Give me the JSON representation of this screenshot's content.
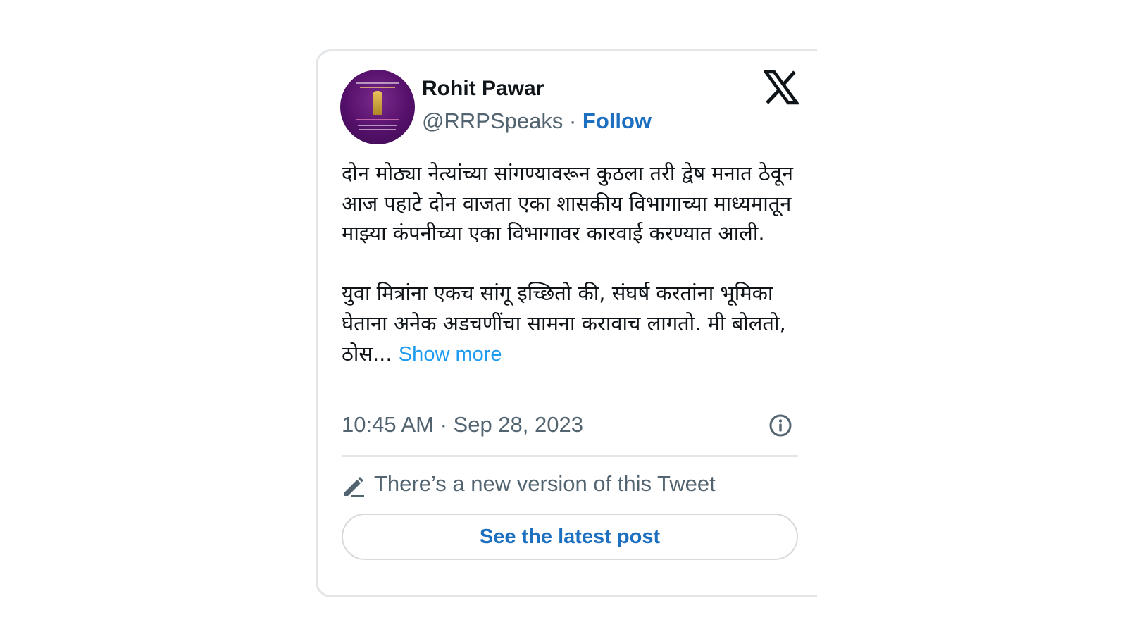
{
  "tweet": {
    "author_name": "Rohit Pawar",
    "handle": "@RRPSpeaks",
    "separator": " · ",
    "follow_label": "Follow",
    "text": "दोन मोठ्या नेत्यांच्या सांगण्यावरून कुठला तरी द्वेष मनात ठेवून आज पहाटे दोन वाजता एका शासकीय विभागाच्या माध्यमातून माझ्या कंपनीच्या एका विभागावर कारवाई करण्यात आली.\n\nयुवा मित्रांना एकच सांगू इच्छितो की, संघर्ष करतांना भूमिका घेताना अनेक अडचणींचा सामना करावाच लागतो. मी बोलतो, ठोस... ",
    "show_more_label": "Show more",
    "timestamp": "10:45 AM · Sep 28, 2023",
    "edit_notice": "There’s a new version of this Tweet",
    "latest_button_label": "See the latest post"
  },
  "icons": {
    "brand": "x-logo-icon",
    "info": "info-icon",
    "edit": "pencil-icon"
  },
  "colors": {
    "link": "#1d6fc0",
    "show_more": "#1d9bf0",
    "secondary_text": "#536471",
    "primary_text": "#0f1419",
    "border": "#e3e6e8"
  }
}
